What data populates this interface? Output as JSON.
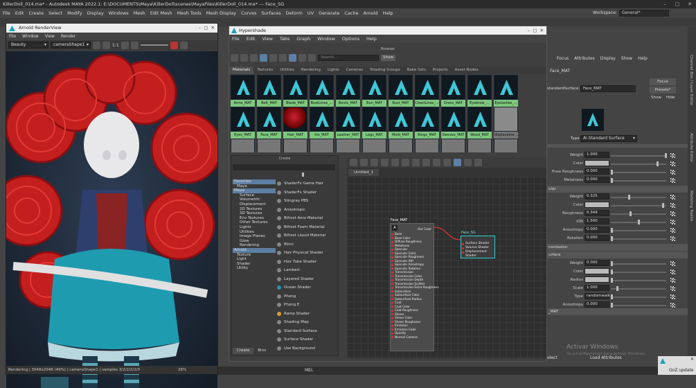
{
  "maya": {
    "title": "KillerDoll_014.ma* - Autodesk MAYA 2022.1: E:\\DOCUMENTS\\Maya\\KillerDoll\\scenes\\MayaFiles\\KillerDoll_014.ma* --- Face_SG",
    "menu": [
      "File",
      "Edit",
      "Create",
      "Select",
      "Modify",
      "Display",
      "Windows",
      "Mesh",
      "Edit Mesh",
      "Mesh Tools",
      "Mesh Display",
      "Curves",
      "Surfaces",
      "Deform",
      "UV",
      "Generate",
      "Cache",
      "Arnold",
      "Help"
    ],
    "workspace_label": "Workspace:",
    "workspace_value": "General*"
  },
  "arnold_render_view": {
    "title": "Arnold RenderView",
    "menu": [
      "File",
      "Window",
      "View",
      "Render"
    ],
    "aov": "Beauty",
    "camera": "cameraShape1",
    "ratio": "1:1",
    "status": "Rendering | 3048x2048 (49%) | cameraShape1 | samples 3/2/2/2/2/0",
    "zoom": "26%"
  },
  "hypershade": {
    "title": "Hypershade",
    "menu": [
      "File",
      "Edit",
      "View",
      "Tabs",
      "Graph",
      "Window",
      "Options",
      "Help"
    ],
    "browser_label": "Browser",
    "search_placeholder": "Search...",
    "show_label": "Show",
    "tabs": [
      "Materials",
      "Textures",
      "Utilities",
      "Rendering",
      "Lights",
      "Cameras",
      "Shading Groups",
      "Bake Sets",
      "Projects",
      "Asset Nodes"
    ],
    "materials_row1": [
      "Arms_MAT",
      "Belt_MAT",
      "Blade_MAT",
      "BootLines_...",
      "Boots_MAT",
      "Bun_MAT",
      "Bust_MAT",
      "ChestLines_...",
      "Dress_MAT",
      "Eyebrow_...",
      "Eyelashes_..."
    ],
    "materials_row2": [
      "Eyes_MAT",
      "Face_MAT",
      "Hair_MAT",
      "Iris_MAT",
      "Leather_MAT",
      "Legs_MAT",
      "Mold_MAT",
      "Rings_MAT",
      "Sleeves_MAT",
      "Wood_MAT",
      "displaceme..."
    ],
    "create_label": "Create",
    "tree": [
      {
        "label": "Favorites",
        "indent": 0,
        "sel": true
      },
      {
        "label": "Maya",
        "indent": 1,
        "sel": false
      },
      {
        "label": "Maya",
        "indent": 0,
        "sel": true
      },
      {
        "label": "Surface",
        "indent": 2,
        "sel": false
      },
      {
        "label": "Volumetric",
        "indent": 2,
        "sel": false
      },
      {
        "label": "Displacement",
        "indent": 2,
        "sel": false
      },
      {
        "label": "2D Textures",
        "indent": 2,
        "sel": false
      },
      {
        "label": "3D Textures",
        "indent": 2,
        "sel": false
      },
      {
        "label": "Env Textures",
        "indent": 2,
        "sel": false
      },
      {
        "label": "Other Textures",
        "indent": 2,
        "sel": false
      },
      {
        "label": "Lights",
        "indent": 2,
        "sel": false
      },
      {
        "label": "Utilities",
        "indent": 2,
        "sel": false
      },
      {
        "label": "Image Planes",
        "indent": 2,
        "sel": false
      },
      {
        "label": "Glow",
        "indent": 2,
        "sel": false
      },
      {
        "label": "Rendering",
        "indent": 2,
        "sel": false
      },
      {
        "label": "Arnold",
        "indent": 0,
        "sel": true
      },
      {
        "label": "Texture",
        "indent": 1,
        "sel": false
      },
      {
        "label": "Light",
        "indent": 1,
        "sel": false
      },
      {
        "label": "Shader",
        "indent": 1,
        "sel": false
      },
      {
        "label": "Utility",
        "indent": 1,
        "sel": false
      }
    ],
    "shaders": [
      "ShaderFx Game Hair",
      "ShaderFx Shader",
      "Stingray PBS",
      "Anisotropic",
      "Bifrost Aero Material",
      "Bifrost Foam Material",
      "Bifrost Liquid Material",
      "Blinn",
      "Hair Physical Shader",
      "Hair Tube Shader",
      "Lambert",
      "Layered Shader",
      "Ocean Shader",
      "Phong",
      "Phong E",
      "Ramp Shader",
      "Shading Map",
      "Standard Surface",
      "Surface Shader",
      "Use Background"
    ],
    "create_tabs": [
      "Create",
      "Bins"
    ],
    "graph_tab": "Untitled_1",
    "node_material": "Face_MAT",
    "node_material_out": "Out Color",
    "node_material_attrs": [
      "Base",
      "Base Color",
      "Diffuse Roughness",
      "Metalness",
      "Specular",
      "Specular Color",
      "Specular Roughness",
      "Specular IOR",
      "Specular Anisotropy",
      "Specular Rotation",
      "Transmission",
      "Transmission Color",
      "Transmission Depth",
      "Transmission Scatter",
      "Transmission Extra Roughness",
      "Subsurface",
      "Subsurface Color",
      "Subsurface Radius",
      "Coat",
      "Coat Color",
      "Coat Roughness",
      "Sheen",
      "Sheen Color",
      "Sheen Roughness",
      "Emission",
      "Emission Color",
      "Opacity",
      "Normal Camera"
    ],
    "node_sg": "Face_SG",
    "node_sg_attrs": [
      "Surface Shader",
      "Volume Shader",
      "Displacement Shader"
    ]
  },
  "attribute_editor": {
    "menu": [
      "Focus",
      "Attributes",
      "Display",
      "Show",
      "Help"
    ],
    "tab": "Face_MAT",
    "node_label": "standardSurface:",
    "node_value": "Face_MAT",
    "focus_btn": "Focus",
    "presets_btn": "Presets*",
    "show_btn": "Show",
    "hide_btn": "Hide",
    "type_label": "Type",
    "type_value": "Ai Standard Surface",
    "base": [
      {
        "name": "Weight",
        "value": "1.000",
        "fill": 1.0
      },
      {
        "name": "Color",
        "value": "",
        "fill": 0.85
      },
      {
        "name": "ffuse Roughness",
        "value": "0.000",
        "fill": 0.0
      },
      {
        "name": "Metalness",
        "value": "0.000",
        "fill": 0.0
      }
    ],
    "specular_section": "ular",
    "specular": [
      {
        "name": "Weight",
        "value": "0.325",
        "fill": 0.32
      },
      {
        "name": "Color",
        "value": "",
        "fill": 0.95
      },
      {
        "name": "Roughness",
        "value": "0.344",
        "fill": 0.34
      },
      {
        "name": "IOR",
        "value": "1.500",
        "fill": 0.5
      },
      {
        "name": "Anisotropy",
        "value": "0.000",
        "fill": 0.0
      },
      {
        "name": "Rotation",
        "value": "0.000",
        "fill": 0.0
      }
    ],
    "transmission_section": "nsmission",
    "subsurface_section": "urface",
    "subsurface": [
      {
        "name": "Weight",
        "value": "0.000",
        "fill": 0.0
      },
      {
        "name": "Color",
        "value": "",
        "fill": 0.0
      },
      {
        "name": "Radius",
        "value": "",
        "fill": 0.0
      },
      {
        "name": "Scale",
        "value": "1.000",
        "fill": 0.1
      },
      {
        "name": "Type",
        "value": "randomwalk",
        "fill": 0.0
      },
      {
        "name": "Anisotropy",
        "value": "0.000",
        "fill": 0.0
      }
    ],
    "bottom_section": "_MAT",
    "select_label": "elect",
    "load_attributes": "Load Attributes",
    "side_tabs": [
      "Channel Box / Layer Editor",
      "Attribute Editor",
      "Modeling Toolkit"
    ]
  },
  "windows_notice": {
    "title": "Activar Windows",
    "subtitle": "Ve a Configuración para activar Windows."
  },
  "goz": "GoZ update",
  "command_line": "MEL"
}
